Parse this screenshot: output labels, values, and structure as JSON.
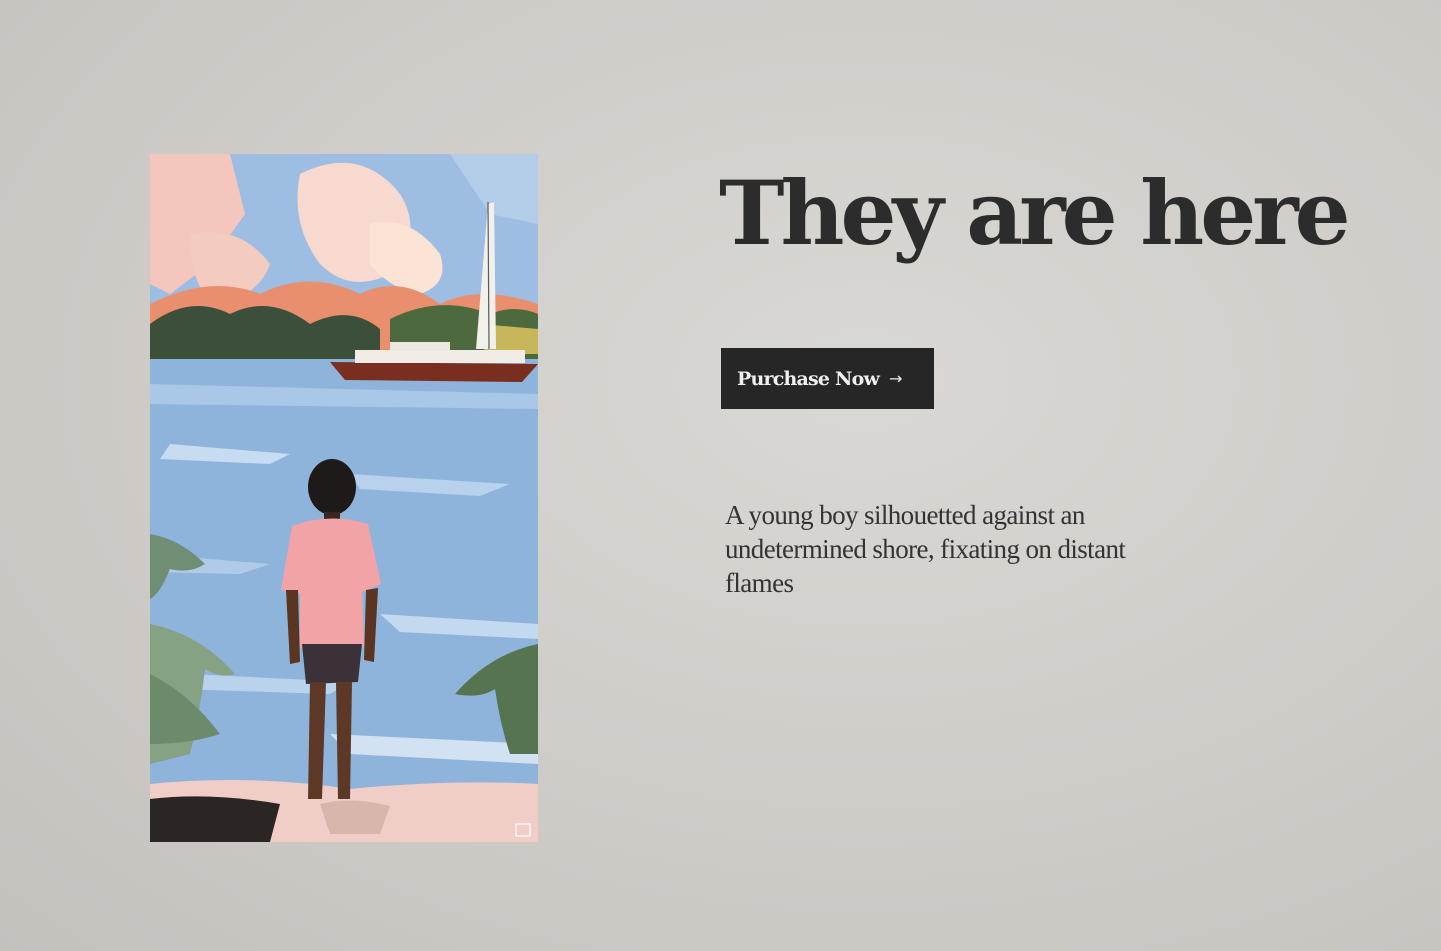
{
  "hero": {
    "title": "They are here",
    "purchase_label": "Purchase Now",
    "purchase_icon": "arrow-right-icon",
    "description": "A young boy silhouetted against an undetermined shore, fixating on distant flames"
  },
  "colors": {
    "background": "#d6d3cf",
    "title": "#2c2c2c",
    "button_bg": "#262626",
    "button_text": "#f1efec",
    "body_text": "#333333"
  }
}
